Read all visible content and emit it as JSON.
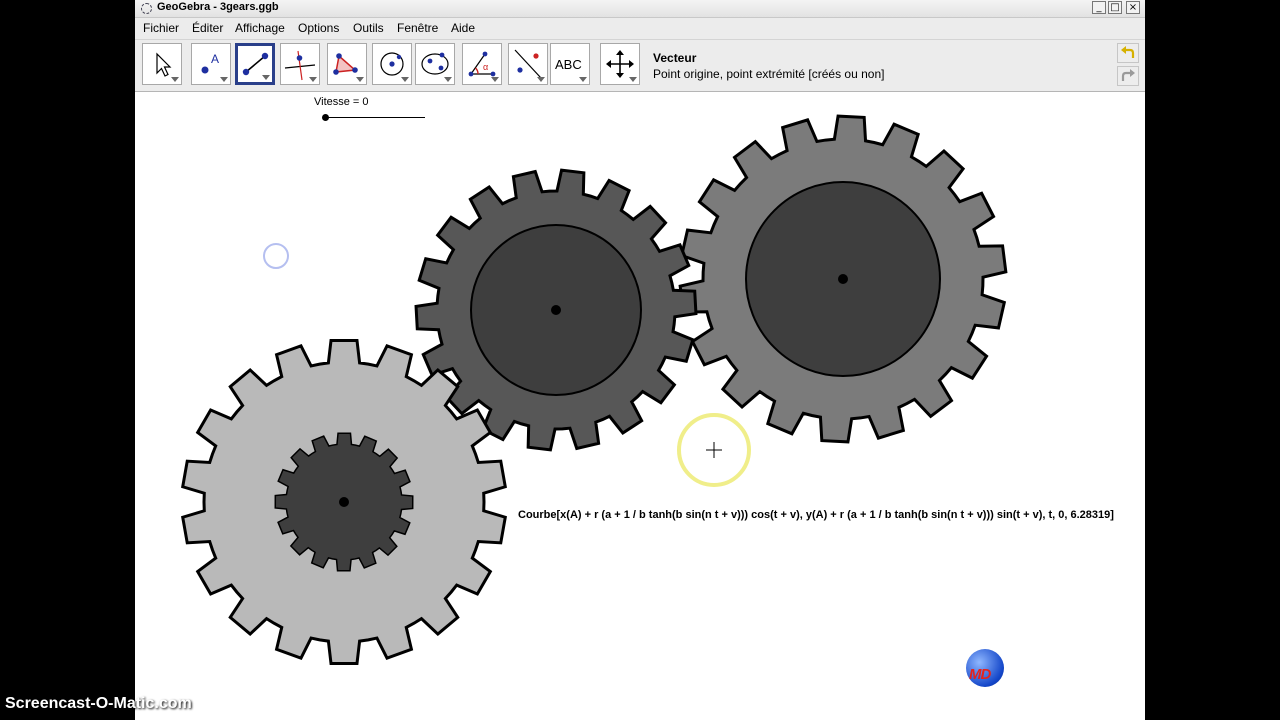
{
  "window": {
    "title": "GeoGebra - 3gears.ggb",
    "minimize": "_",
    "maximize": "□",
    "close": "×"
  },
  "menu": [
    "Fichier",
    "Éditer",
    "Affichage",
    "Options",
    "Outils",
    "Fenêtre",
    "Aide"
  ],
  "toolbar": {
    "text_tool_label": "ABC",
    "active_tool": {
      "title": "Vecteur",
      "description": "Point origine, point extrémité [créés ou non]"
    }
  },
  "graphics": {
    "slider_label": "Vitesse = 0",
    "formula": "Courbe[x(A) + r (a + 1 / b tanh(b sin(n t + v))) cos(t + v), y(A) + r (a + 1 / b tanh(b sin(n t + v))) sin(t + v), t, 0, 6.28319]",
    "logo_text": "MD"
  },
  "overlay": {
    "watermark": "Screencast-O-Matic.com"
  },
  "colors": {
    "gear_light": "#b9b9b9",
    "gear_medium": "#7b7b7b",
    "gear_dark": "#575757",
    "gear_hub": "#3e3e3e",
    "selected_tool_border": "#2a3f8a",
    "highlight": "#f0ee8a"
  }
}
